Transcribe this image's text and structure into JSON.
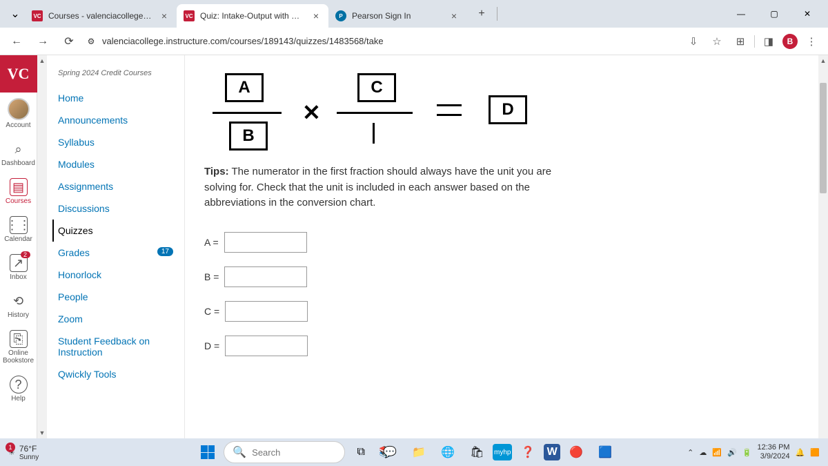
{
  "browser": {
    "tabs": [
      {
        "favicon": "VC",
        "title": "Courses - valenciacollege.edu"
      },
      {
        "favicon": "VC",
        "title": "Quiz: Intake-Output with Dimen"
      },
      {
        "favicon": "P",
        "title": "Pearson Sign In"
      }
    ],
    "url": "valenciacollege.instructure.com/courses/189143/quizzes/1483568/take",
    "profile_letter": "B"
  },
  "global_nav": {
    "items": [
      "Account",
      "Dashboard",
      "Courses",
      "Calendar",
      "Inbox",
      "History",
      "Online Bookstore",
      "Help"
    ],
    "inbox_badge": "2"
  },
  "course_nav": {
    "term": "Spring 2024 Credit Courses",
    "links": [
      "Home",
      "Announcements",
      "Syllabus",
      "Modules",
      "Assignments",
      "Discussions",
      "Quizzes",
      "Grades",
      "Honorlock",
      "People",
      "Zoom",
      "Student Feedback on Instruction",
      "Qwickly Tools"
    ],
    "grades_badge": "17"
  },
  "quiz": {
    "boxes": {
      "A": "A",
      "B": "B",
      "C": "C",
      "D": "D"
    },
    "tips_label": "Tips:",
    "tips_text": " The numerator in the first fraction should always have the unit you are solving for. Check that the unit is included in each answer based on the abbreviations in the conversion chart.",
    "labels": {
      "A": "A =",
      "B": "B =",
      "C": "C =",
      "D": "D ="
    }
  },
  "taskbar": {
    "weather_badge": "1",
    "temp": "76°F",
    "cond": "Sunny",
    "search_placeholder": "Search",
    "time": "12:36 PM",
    "date": "3/9/2024"
  }
}
